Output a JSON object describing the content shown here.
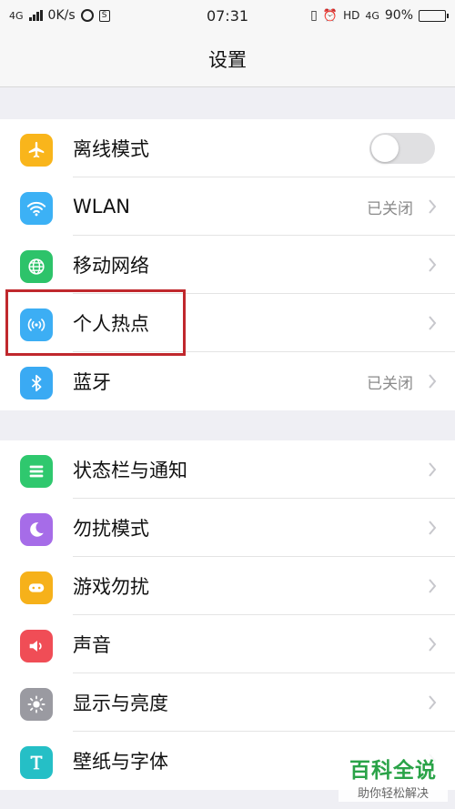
{
  "status_bar": {
    "network": "4G",
    "speed": "0K/s",
    "time": "07:31",
    "hd": "HD",
    "network_right": "4G",
    "battery": "90%",
    "battery_level": 0.9
  },
  "header": {
    "title": "设置"
  },
  "group1": [
    {
      "label": "离线模式",
      "icon": "airplane-icon",
      "color": "#f9b51b",
      "control": "toggle",
      "toggle_on": false
    },
    {
      "label": "WLAN",
      "icon": "wifi-icon",
      "color": "#3cb1f5",
      "value": "已关闭"
    },
    {
      "label": "移动网络",
      "icon": "globe-icon",
      "color": "#2dc36a"
    },
    {
      "label": "个人热点",
      "icon": "hotspot-icon",
      "color": "#3caef4"
    },
    {
      "label": "蓝牙",
      "icon": "bluetooth-icon",
      "color": "#3aaaf3",
      "value": "已关闭"
    }
  ],
  "group2": [
    {
      "label": "状态栏与通知",
      "icon": "statusbar-icon",
      "color": "#2fc86e"
    },
    {
      "label": "勿扰模式",
      "icon": "moon-icon",
      "color": "#a66ce8"
    },
    {
      "label": "游戏勿扰",
      "icon": "gamepad-icon",
      "color": "#f6b11a"
    },
    {
      "label": "声音",
      "icon": "speaker-icon",
      "color": "#f04d56"
    },
    {
      "label": "显示与亮度",
      "icon": "brightness-icon",
      "color": "#9a9aa1"
    },
    {
      "label": "壁纸与字体",
      "icon": "font-icon",
      "color": "#25bfc6"
    }
  ],
  "watermark": {
    "title": "百科全说",
    "subtitle": "助你轻松解决"
  },
  "highlight_color": "#c0282d"
}
